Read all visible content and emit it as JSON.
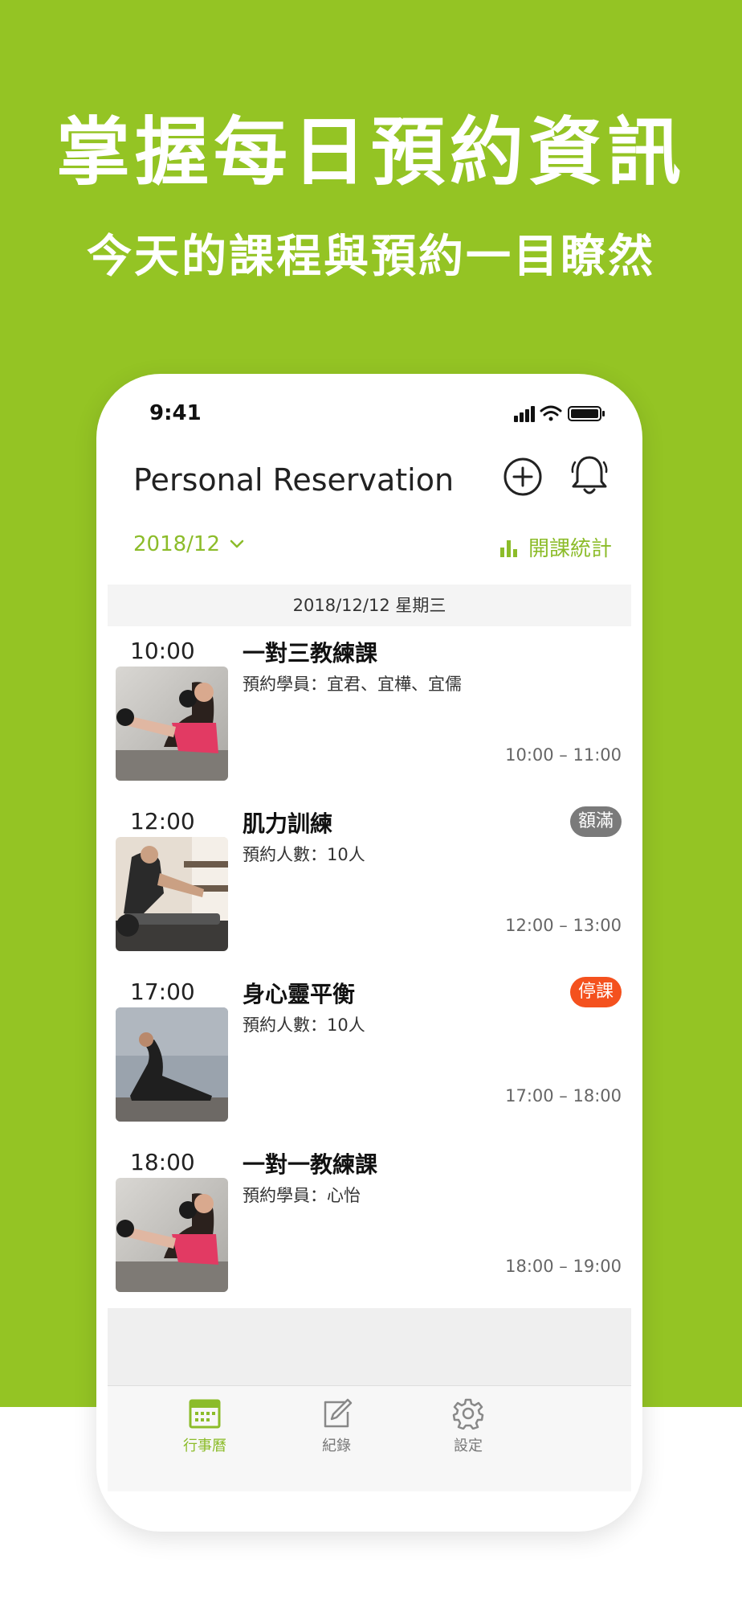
{
  "promo": {
    "headline": "掌握每日預約資訊",
    "subline": "今天的課程與預約一目瞭然"
  },
  "status_bar": {
    "time": "9:41"
  },
  "header": {
    "title": "Personal Reservation",
    "add_icon": "plus-circle-icon",
    "bell_icon": "bell-icon"
  },
  "toolbar": {
    "month": "2018/12",
    "month_icon": "chevron-down-icon",
    "stats_label": "開課統計",
    "stats_icon": "bar-chart-icon"
  },
  "date_header": "2018/12/12 星期三",
  "classes": [
    {
      "time": "10:00",
      "title": "一對三教練課",
      "detail": "預約學員：宜君、宜樺、宜儒",
      "range": "10:00 – 11:00",
      "badge": ""
    },
    {
      "time": "12:00",
      "title": "肌力訓練",
      "detail": "預約人數：10人",
      "range": "12:00 – 13:00",
      "badge": "額滿"
    },
    {
      "time": "17:00",
      "title": "身心靈平衡",
      "detail": "預約人數：10人",
      "range": "17:00 – 18:00",
      "badge": "停課"
    },
    {
      "time": "18:00",
      "title": "一對一教練課",
      "detail": "預約學員：心怡",
      "range": "18:00 – 19:00",
      "badge": ""
    }
  ],
  "tabs": [
    {
      "label": "行事曆",
      "icon": "calendar-icon",
      "active": true
    },
    {
      "label": "紀錄",
      "icon": "edit-icon",
      "active": false
    },
    {
      "label": "設定",
      "icon": "gear-icon",
      "active": false
    }
  ],
  "colors": {
    "brand_green": "#94c424",
    "accent_green": "#8cbc2a",
    "badge_full": "#7a7a7a",
    "badge_cancelled": "#f4511e"
  }
}
